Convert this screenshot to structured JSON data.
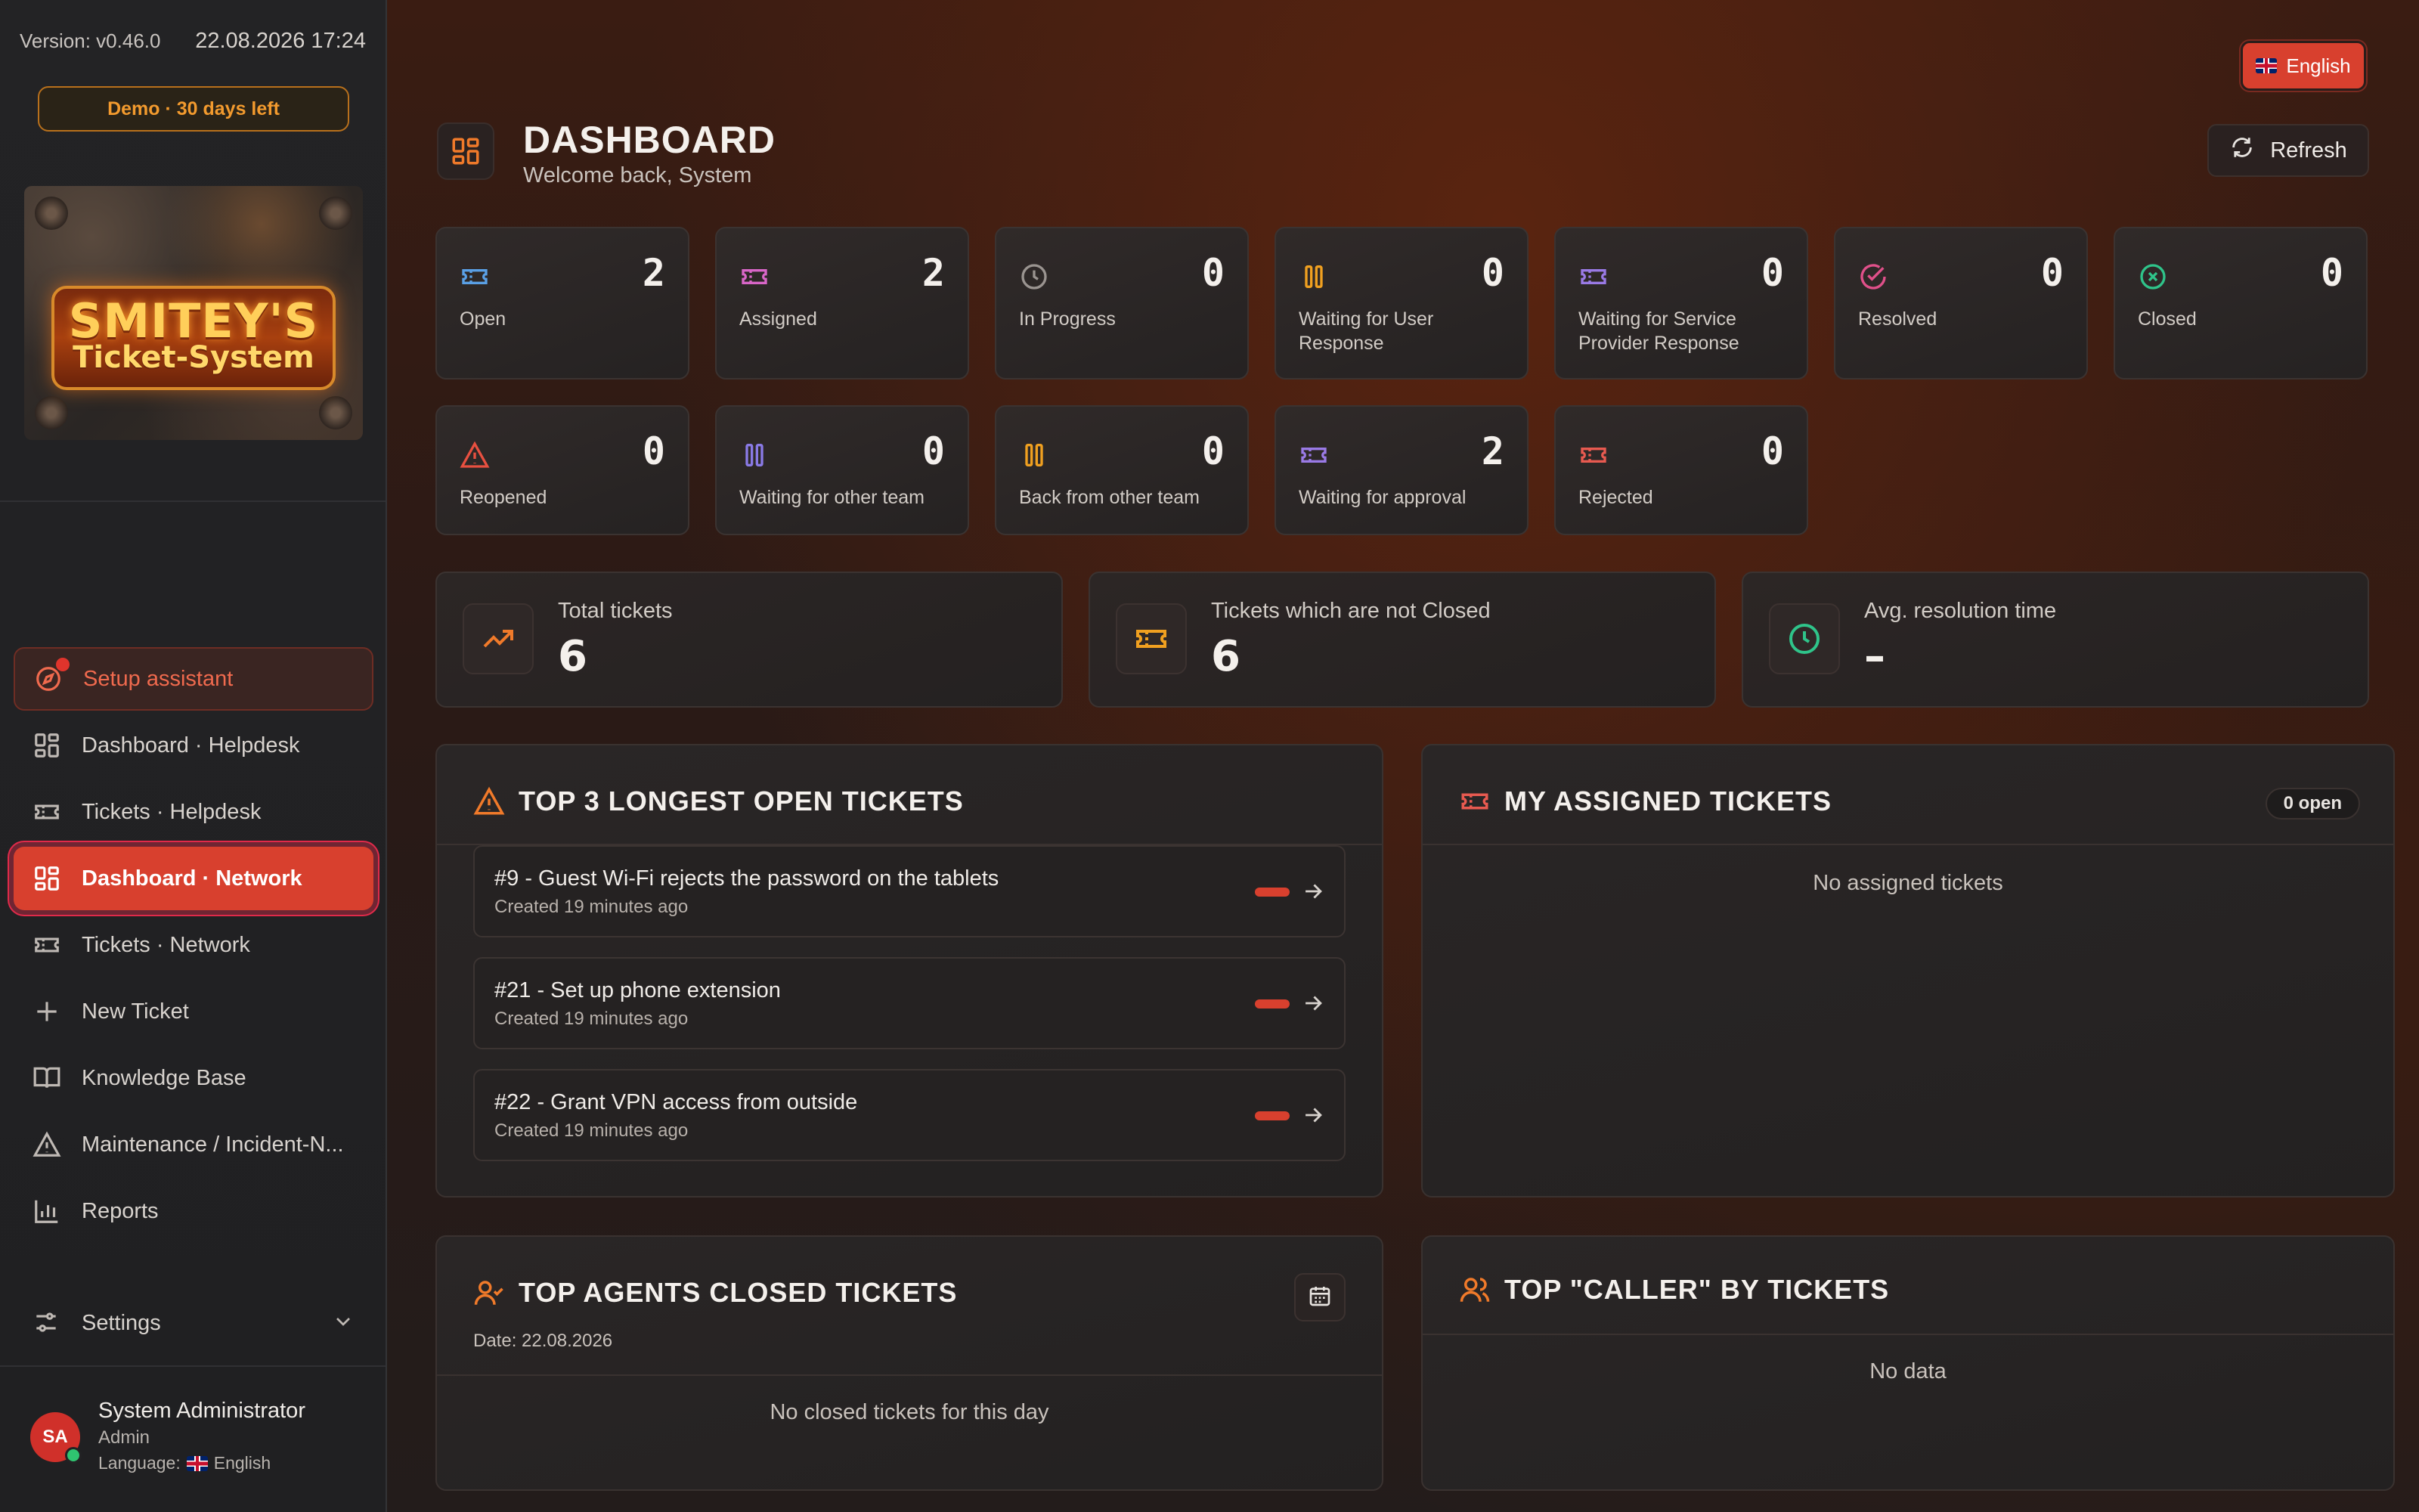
{
  "sidebar": {
    "version": "Version: v0.46.0",
    "datetime": "22.08.2026  17:24",
    "demo_badge": "Demo · 30 days left",
    "logo_line1": "SMITEY'S",
    "logo_line2": "Ticket-System",
    "nav": [
      {
        "label": "Setup assistant",
        "icon": "compass-icon"
      },
      {
        "label": "Dashboard · Helpdesk",
        "icon": "dashboard-grid-icon"
      },
      {
        "label": "Tickets · Helpdesk",
        "icon": "ticket-icon"
      },
      {
        "label": "Dashboard · Network",
        "icon": "dashboard-grid-icon",
        "active": true
      },
      {
        "label": "Tickets · Network",
        "icon": "ticket-icon"
      },
      {
        "label": "New Ticket",
        "icon": "plus-icon"
      },
      {
        "label": "Knowledge Base",
        "icon": "book-open-icon"
      },
      {
        "label": "Maintenance / Incident-N...",
        "icon": "warning-triangle-icon"
      },
      {
        "label": "Reports",
        "icon": "bar-chart-icon"
      }
    ],
    "settings": "Settings",
    "user": {
      "initials": "SA",
      "name": "System Administrator",
      "role": "Admin",
      "language_label": "Language:",
      "language": "English"
    }
  },
  "header": {
    "language_button": "English",
    "title": "DASHBOARD",
    "subtitle": "Welcome back, System",
    "refresh": "Refresh"
  },
  "stats_row1": [
    {
      "label": "Open",
      "value": "2",
      "color": "#5aa0e6",
      "icon": "ticket-icon"
    },
    {
      "label": "Assigned",
      "value": "2",
      "color": "#d966c8",
      "icon": "ticket-icon"
    },
    {
      "label": "In Progress",
      "value": "0",
      "color": "#9a9490",
      "icon": "clock-icon"
    },
    {
      "label": "Waiting for User Response",
      "value": "0",
      "color": "#f0a020",
      "icon": "pause-icon"
    },
    {
      "label": "Waiting for Service Provider Response",
      "value": "0",
      "color": "#9a7ae6",
      "icon": "ticket-icon"
    },
    {
      "label": "Resolved",
      "value": "0",
      "color": "#e0508a",
      "icon": "check-circle-icon"
    },
    {
      "label": "Closed",
      "value": "0",
      "color": "#2fc48a",
      "icon": "x-circle-icon"
    }
  ],
  "stats_row2": [
    {
      "label": "Reopened",
      "value": "0",
      "color": "#e85040",
      "icon": "warning-triangle-icon"
    },
    {
      "label": "Waiting for other team",
      "value": "0",
      "color": "#8a7ae6",
      "icon": "pause-icon"
    },
    {
      "label": "Back from other team",
      "value": "0",
      "color": "#f0a020",
      "icon": "pause-icon"
    },
    {
      "label": "Waiting for approval",
      "value": "2",
      "color": "#9a7ae6",
      "icon": "ticket-icon"
    },
    {
      "label": "Rejected",
      "value": "0",
      "color": "#e85a50",
      "icon": "ticket-icon"
    }
  ],
  "summary": [
    {
      "label": "Total tickets",
      "value": "6",
      "icon": "trending-up-icon",
      "color": "#f07a2a"
    },
    {
      "label": "Tickets which are not Closed",
      "value": "6",
      "icon": "ticket-icon",
      "color": "#f0a020"
    },
    {
      "label": "Avg. resolution time",
      "value": "–",
      "icon": "clock-icon",
      "color": "#2fc48a"
    }
  ],
  "longest_open": {
    "title": "TOP 3 LONGEST OPEN TICKETS",
    "tickets": [
      {
        "title": "#9 - Guest Wi-Fi rejects the password on the tablets",
        "created": "Created 19 minutes ago"
      },
      {
        "title": "#21 - Set up phone extension",
        "created": "Created 19 minutes ago"
      },
      {
        "title": "#22 - Grant VPN access from outside",
        "created": "Created 19 minutes ago"
      }
    ]
  },
  "my_assigned": {
    "title": "MY ASSIGNED TICKETS",
    "badge": "0 open",
    "empty": "No assigned tickets"
  },
  "top_agents": {
    "title": "TOP AGENTS CLOSED TICKETS",
    "date": "Date: 22.08.2026",
    "empty": "No closed tickets for this day"
  },
  "top_callers": {
    "title": "TOP \"CALLER\" BY TICKETS",
    "empty": "No data"
  },
  "colors": {
    "accent": "#d8402e",
    "orange": "#f07a2a",
    "active_outline": "#e02a4a"
  }
}
